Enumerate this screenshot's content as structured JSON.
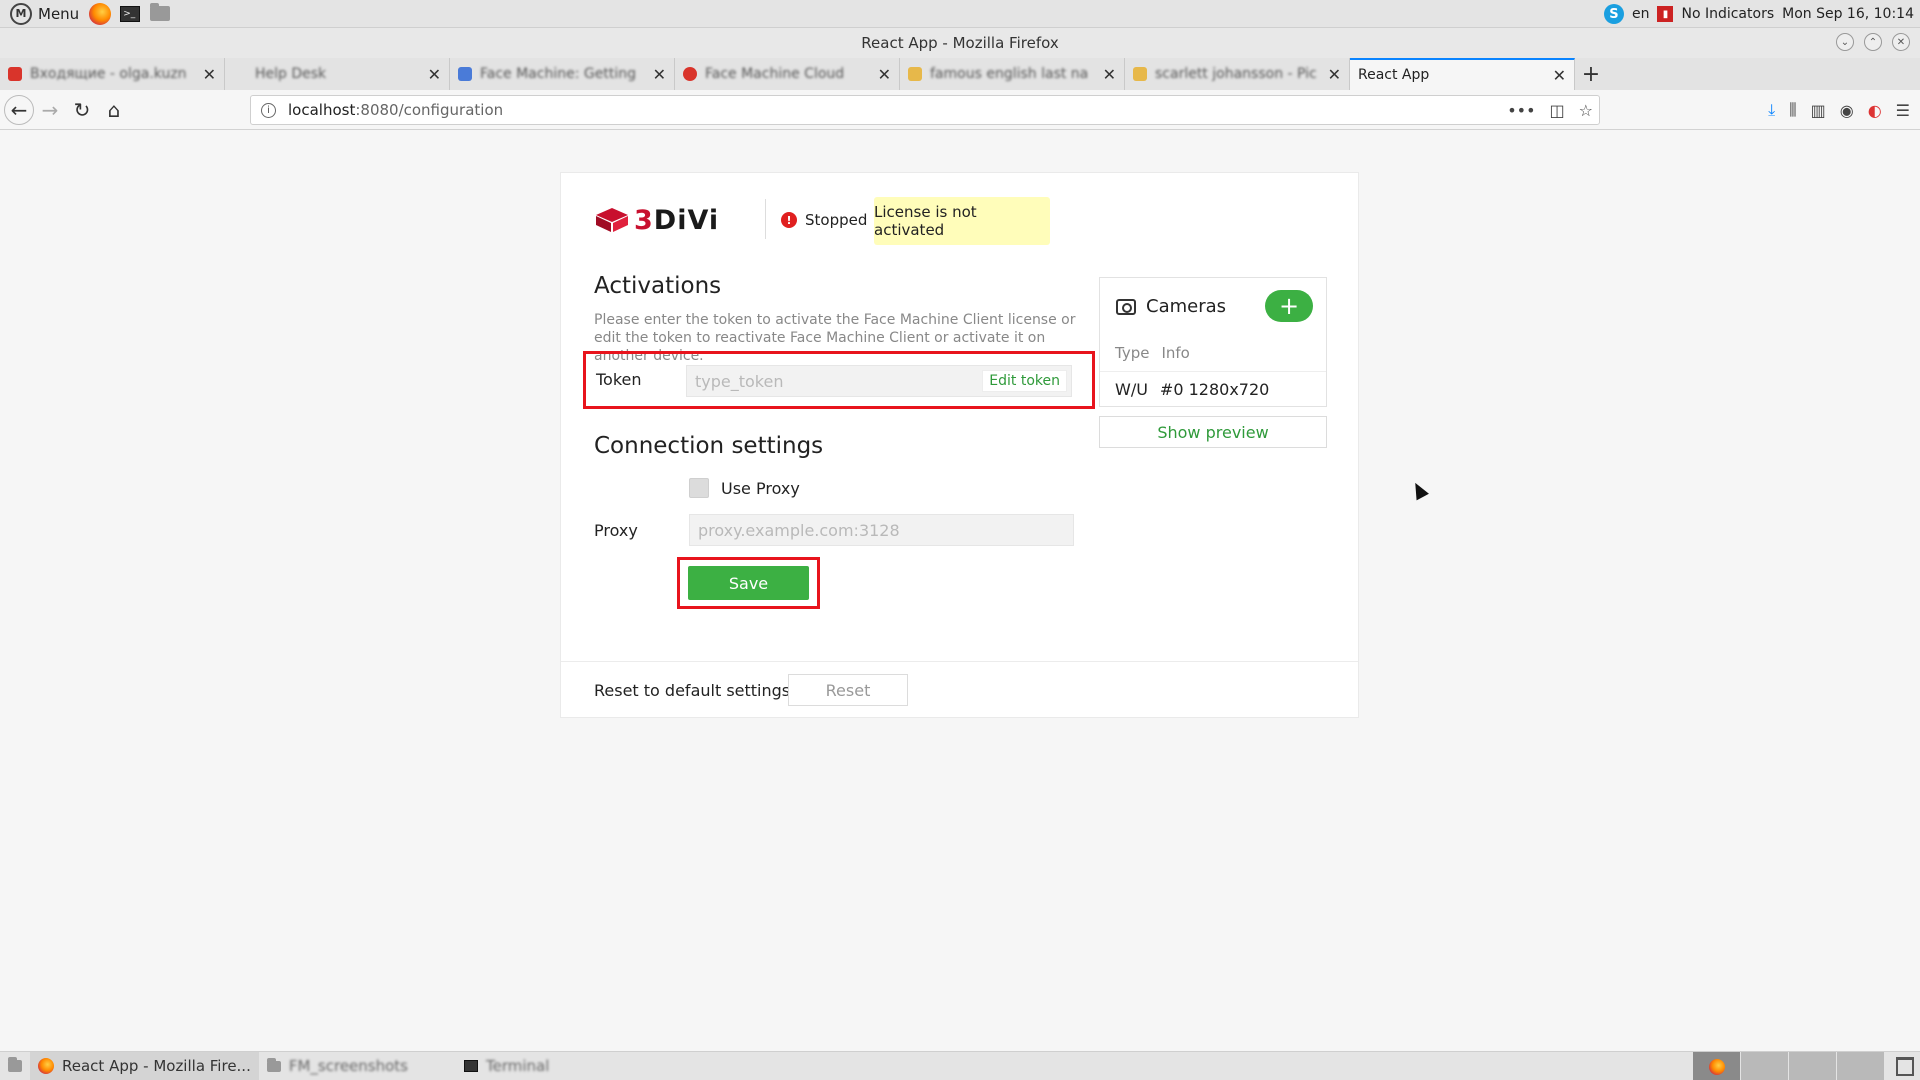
{
  "os": {
    "menu_label": "Menu",
    "lang": "en",
    "indicators_label": "No Indicators",
    "clock": "Mon Sep 16, 10:14"
  },
  "window": {
    "title": "React App - Mozilla Firefox"
  },
  "tabs": [
    {
      "label": "Входящие - olga.kuzn",
      "fav_color": "#d9342b"
    },
    {
      "label": "Help Desk",
      "fav_color": "#e3e3e3"
    },
    {
      "label": "Face Machine: Getting",
      "fav_color": "#4a7bd8"
    },
    {
      "label": "Face Machine Cloud",
      "fav_color": "#d9342b"
    },
    {
      "label": "famous english last na",
      "fav_color": "#e7b84a"
    },
    {
      "label": "scarlett johansson - Pic",
      "fav_color": "#e7b84a"
    },
    {
      "label": "React App",
      "fav_color": "#f6f6f6"
    }
  ],
  "address": {
    "host": "localhost",
    "path": ":8080/configuration"
  },
  "brand": {
    "text_r": "3",
    "text_rest": "DiVi"
  },
  "status": {
    "label": "Stopped",
    "license": "License is not activated"
  },
  "activations": {
    "title": "Activations",
    "description": "Please enter the token to activate the Face Machine Client license or edit the token to reactivate Face Machine Client or activate it on another device.",
    "token_label": "Token",
    "token_placeholder": "type_token",
    "edit_token": "Edit token"
  },
  "connection": {
    "title": "Connection settings",
    "use_proxy": "Use Proxy",
    "proxy_label": "Proxy",
    "proxy_placeholder": "proxy.example.com:3128",
    "save": "Save"
  },
  "reset": {
    "label": "Reset to default settings",
    "button": "Reset"
  },
  "cameras": {
    "title": "Cameras",
    "col_type": "Type",
    "col_info": "Info",
    "row_type": "W/U",
    "row_info": "#0 1280x720",
    "show_preview": "Show preview"
  },
  "taskbar": {
    "firefox": "React App - Mozilla Fire...",
    "files": "FM_screenshots",
    "terminal": "Terminal"
  }
}
